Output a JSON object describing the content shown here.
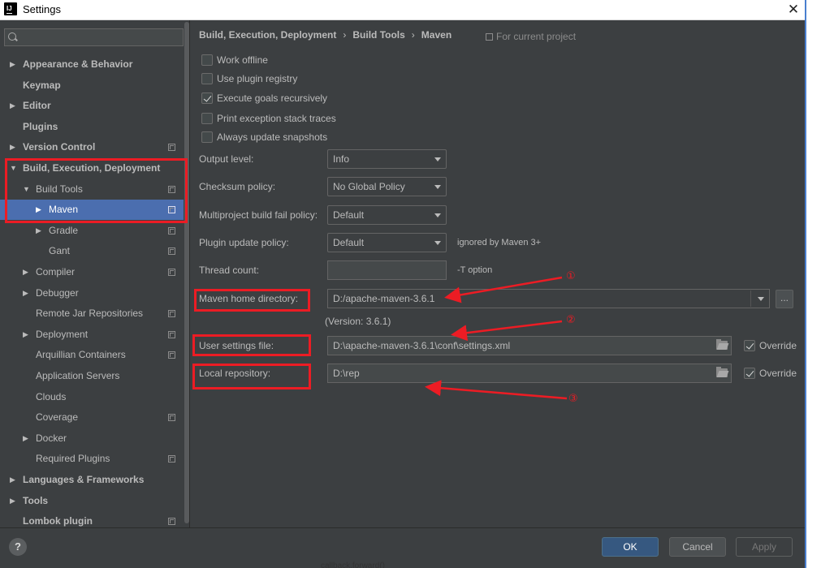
{
  "window": {
    "title": "Settings",
    "app_icon_text": "IJ",
    "close_glyph": "✕"
  },
  "sidebar": {
    "search_placeholder": "",
    "items": [
      {
        "label": "Appearance & Behavior",
        "arrow": "▶",
        "bold": true
      },
      {
        "label": "Keymap",
        "bold": true
      },
      {
        "label": "Editor",
        "arrow": "▶",
        "bold": true
      },
      {
        "label": "Plugins",
        "bold": true
      },
      {
        "label": "Version Control",
        "arrow": "▶",
        "bold": true,
        "project_icon": true
      },
      {
        "label": "Build, Execution, Deployment",
        "arrow": "▼",
        "bold": true
      },
      {
        "label": "Build Tools",
        "arrow": "▼",
        "project_icon": true
      },
      {
        "label": "Maven",
        "arrow": "▶",
        "project_icon": true,
        "selected": true
      },
      {
        "label": "Gradle",
        "arrow": "▶",
        "project_icon": true
      },
      {
        "label": "Gant",
        "project_icon": true
      },
      {
        "label": "Compiler",
        "arrow": "▶",
        "project_icon": true
      },
      {
        "label": "Debugger",
        "arrow": "▶"
      },
      {
        "label": "Remote Jar Repositories",
        "project_icon": true
      },
      {
        "label": "Deployment",
        "arrow": "▶",
        "project_icon": true
      },
      {
        "label": "Arquillian Containers",
        "project_icon": true
      },
      {
        "label": "Application Servers"
      },
      {
        "label": "Clouds"
      },
      {
        "label": "Coverage",
        "project_icon": true
      },
      {
        "label": "Docker",
        "arrow": "▶"
      },
      {
        "label": "Required Plugins",
        "project_icon": true
      },
      {
        "label": "Languages & Frameworks",
        "arrow": "▶",
        "bold": true
      },
      {
        "label": "Tools",
        "arrow": "▶",
        "bold": true
      },
      {
        "label": "Lombok plugin",
        "bold": true,
        "project_icon": true
      }
    ]
  },
  "breadcrumb": {
    "parts": [
      "Build, Execution, Deployment",
      "Build Tools",
      "Maven"
    ],
    "separator": "›",
    "for_project": "For current project"
  },
  "checkboxes": [
    {
      "label": "Work offline",
      "checked": false
    },
    {
      "label": "Use plugin registry",
      "checked": false
    },
    {
      "label": "Execute goals recursively",
      "checked": true
    },
    {
      "label": "Print exception stack traces",
      "checked": false
    },
    {
      "label": "Always update snapshots",
      "checked": false
    }
  ],
  "fields": {
    "output_level": {
      "label": "Output level:",
      "value": "Info"
    },
    "checksum_policy": {
      "label": "Checksum policy:",
      "value": "No Global Policy"
    },
    "multiproject_policy": {
      "label": "Multiproject build fail policy:",
      "value": "Default"
    },
    "plugin_update_policy": {
      "label": "Plugin update policy:",
      "value": "Default",
      "note": "ignored by Maven 3+"
    },
    "thread_count": {
      "label": "Thread count:",
      "value": "",
      "note": "-T option"
    },
    "maven_home": {
      "label": "Maven home directory:",
      "value": "D:/apache-maven-3.6.1",
      "browse": "..."
    },
    "version_note": "(Version: 3.6.1)",
    "user_settings": {
      "label": "User settings file:",
      "value": "D:\\apache-maven-3.6.1\\conf\\settings.xml",
      "override_label": "Override",
      "override_checked": true
    },
    "local_repo": {
      "label": "Local repository:",
      "value": "D:\\rep",
      "override_label": "Override",
      "override_checked": true
    }
  },
  "annotations": [
    "①",
    "②",
    "③"
  ],
  "footer": {
    "help": "?",
    "ok": "OK",
    "cancel": "Cancel",
    "apply": "Apply"
  },
  "peek_text": "callback.forward()",
  "colors": {
    "accent": "#4b6eaf",
    "annotation_red": "#ec1c24",
    "background": "#3c3f41"
  }
}
